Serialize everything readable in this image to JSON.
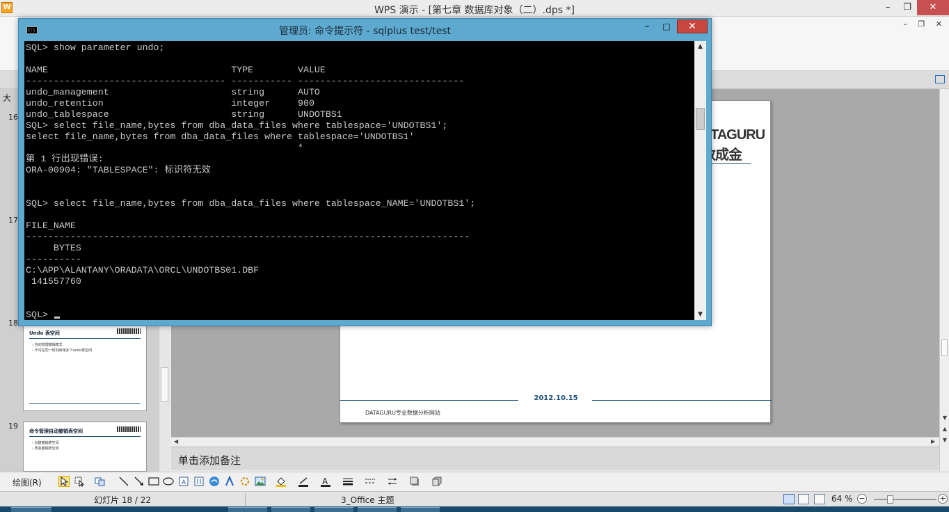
{
  "wps": {
    "title": "WPS 演示 - [第七章 数据库对象（二）.dps *]",
    "logo": "W",
    "controls": {
      "minimize": "–",
      "restore": "❐",
      "close": "✕"
    },
    "mdi_controls": "– ❐ ✕"
  },
  "cmd": {
    "title": "管理员: 命令提示符 - sqlplus  test/test",
    "icon_text": "C:\\",
    "controls": {
      "minimize": "–",
      "maximize": "□",
      "close": "✕"
    },
    "console_lines": [
      "SQL> show parameter undo;",
      "",
      "NAME                                 TYPE        VALUE",
      "------------------------------------ ----------- ------------------------------",
      "undo_management                      string      AUTO",
      "undo_retention                       integer     900",
      "undo_tablespace                      string      UNDOTBS1",
      "SQL> select file_name,bytes from dba_data_files where tablespace='UNDOTBS1';",
      "select file_name,bytes from dba_data_files where tablespace='UNDOTBS1'",
      "                                                 *",
      "第 1 行出现错误:",
      "ORA-00904: \"TABLESPACE\": 标识符无效",
      "",
      "",
      "SQL> select file_name,bytes from dba_data_files where tablespace_NAME='UNDOTBS1';",
      "",
      "FILE_NAME",
      "--------------------------------------------------------------------------------",
      "     BYTES",
      "----------",
      "C:\\APP\\ALANTANY\\ORADATA\\ORCL\\UNDOTBS01.DBF",
      " 141557760",
      "",
      "",
      "SQL> "
    ]
  },
  "slide_pane": {
    "tab_label": "大",
    "slides": [
      {
        "number": "16"
      },
      {
        "number": "17"
      },
      {
        "number": "18",
        "title": "Undo 表空间",
        "bullets": [
          "› 自动管理撤销模式",
          "› 不可在同一时刻启用多个undo表空间"
        ]
      },
      {
        "number": "19",
        "title": "命令管理自动撤销表空间",
        "bullets": [
          "› 创建撤销表空间",
          "› 改变撤销表空间"
        ]
      }
    ]
  },
  "slide": {
    "logo_text": "ATAGURU",
    "logo_sub": "数成金",
    "date": "2012.10.15",
    "site": "DATAGURU专业数据分析网站"
  },
  "notes": {
    "placeholder": "单击添加备注"
  },
  "drawbar": {
    "label": "绘图(R)"
  },
  "status": {
    "slide_counter": "幻灯片 18 / 22",
    "theme": "3_Office 主题",
    "zoom": "64 %",
    "zoom_minus": "−",
    "zoom_plus": "+"
  }
}
